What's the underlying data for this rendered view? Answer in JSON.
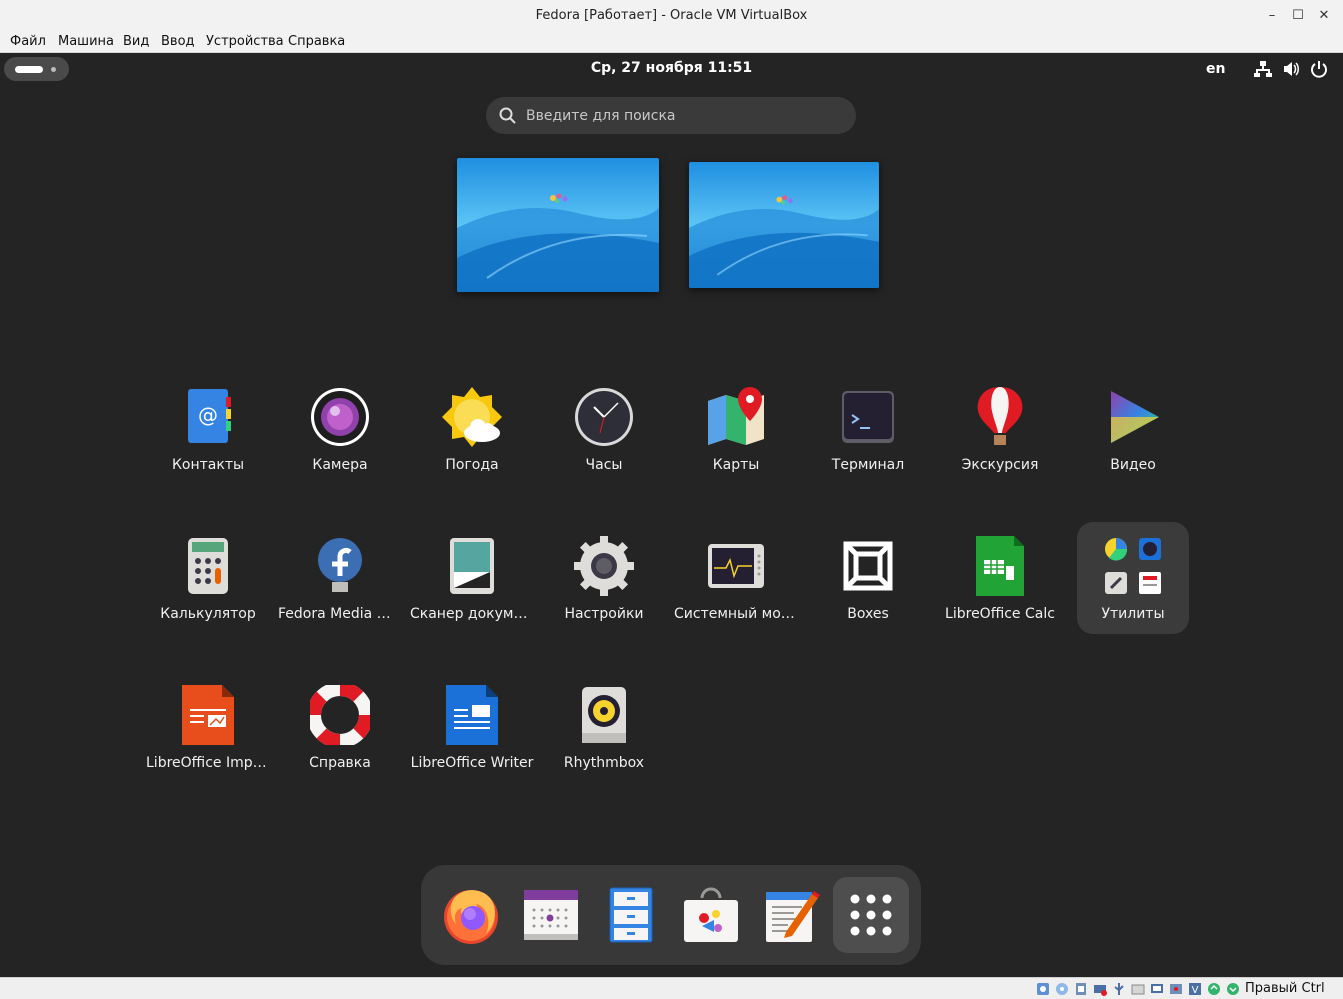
{
  "window": {
    "title": "Fedora [Работает] - Oracle VM VirtualBox",
    "minimize": "–",
    "maximize": "☐",
    "close": "✕"
  },
  "menubar": [
    "Файл",
    "Машина",
    "Вид",
    "Ввод",
    "Устройства",
    "Справка"
  ],
  "topbar": {
    "datetime": "Ср, 27 ноября  11:51",
    "language": "en",
    "tray_icons": [
      "network-icon",
      "volume-icon",
      "power-icon"
    ]
  },
  "search": {
    "placeholder": "Введите для поиска",
    "value": ""
  },
  "workspaces": 2,
  "apps": [
    {
      "label": "Контакты",
      "icon": "contacts-icon"
    },
    {
      "label": "Камера",
      "icon": "camera-icon"
    },
    {
      "label": "Погода",
      "icon": "weather-icon"
    },
    {
      "label": "Часы",
      "icon": "clock-icon"
    },
    {
      "label": "Карты",
      "icon": "maps-icon"
    },
    {
      "label": "Терминал",
      "icon": "terminal-icon"
    },
    {
      "label": "Экскурсия",
      "icon": "tour-icon"
    },
    {
      "label": "Видео",
      "icon": "video-icon"
    },
    {
      "label": "Калькулятор",
      "icon": "calculator-icon"
    },
    {
      "label": "Fedora Media Writer",
      "icon": "fedora-icon"
    },
    {
      "label": "Сканер документов",
      "icon": "scanner-icon"
    },
    {
      "label": "Настройки",
      "icon": "settings-icon"
    },
    {
      "label": "Системный монитор",
      "icon": "system-monitor-icon"
    },
    {
      "label": "Boxes",
      "icon": "boxes-icon"
    },
    {
      "label": "LibreOffice Calc",
      "icon": "libreoffice-calc-icon"
    },
    {
      "label": "Утилиты",
      "icon": "utilities-folder-icon"
    },
    {
      "label": "LibreOffice Impress",
      "icon": "libreoffice-impress-icon"
    },
    {
      "label": "Справка",
      "icon": "help-icon"
    },
    {
      "label": "LibreOffice Writer",
      "icon": "libreoffice-writer-icon"
    },
    {
      "label": "Rhythmbox",
      "icon": "rhythmbox-icon"
    }
  ],
  "dock": [
    "firefox-icon",
    "calendar-icon",
    "files-icon",
    "software-icon",
    "text-editor-icon",
    "show-apps-icon"
  ],
  "statusbar": {
    "host_key": "Правый Ctrl"
  }
}
